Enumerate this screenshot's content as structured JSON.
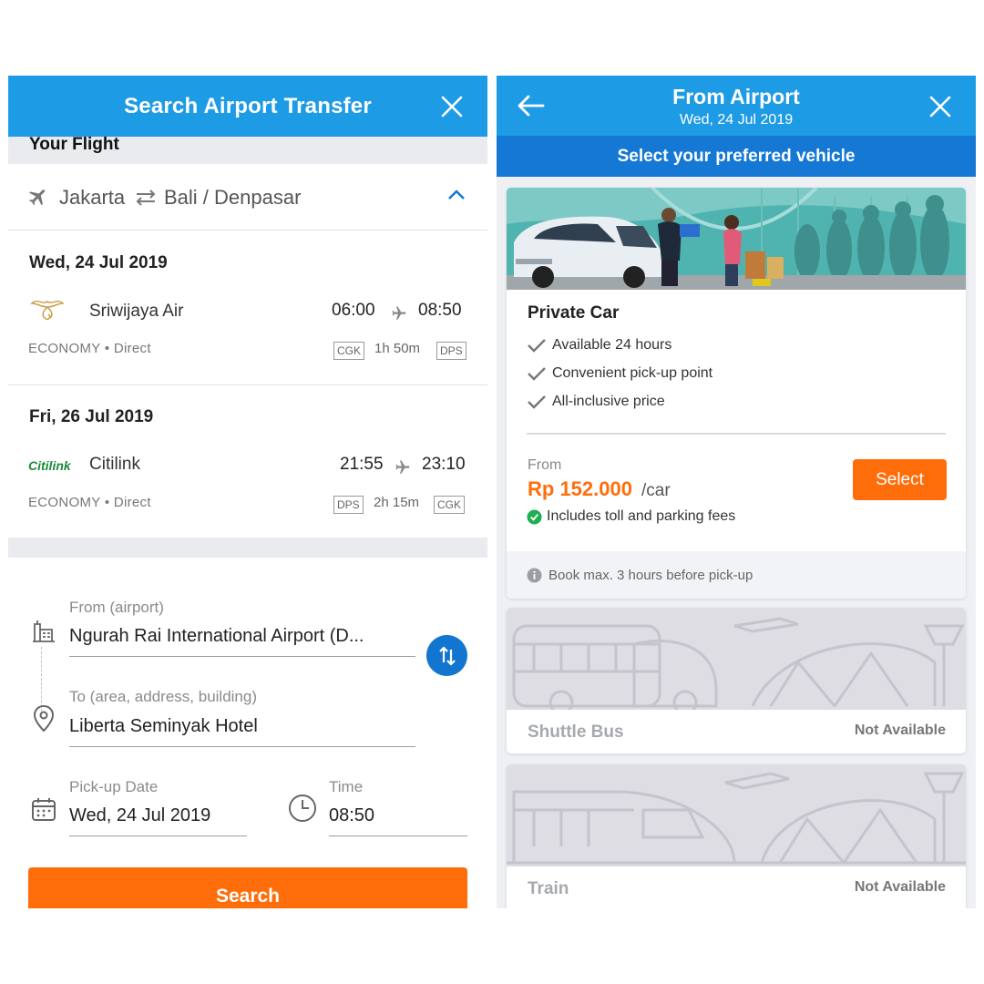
{
  "left": {
    "header": {
      "title": "Search Airport Transfer"
    },
    "section_title": "Your Flight",
    "route": {
      "origin": "Jakarta",
      "destination": "Bali / Denpasar"
    },
    "flights": [
      {
        "date": "Wed, 24 Jul 2019",
        "airline": "Sriwijaya Air",
        "depart": "06:00",
        "arrive": "08:50",
        "cabin": "ECONOMY",
        "separator": "•",
        "type": "Direct",
        "from_code": "CGK",
        "duration": "1h 50m",
        "to_code": "DPS"
      },
      {
        "date": "Fri, 26 Jul 2019",
        "airline": "Citilink",
        "airline_logo_text": "Citilink",
        "depart": "21:55",
        "arrive": "23:10",
        "cabin": "ECONOMY",
        "separator": "•",
        "type": "Direct",
        "from_code": "DPS",
        "duration": "2h 15m",
        "to_code": "CGK"
      }
    ],
    "form": {
      "from_label": "From (airport)",
      "from_value": "Ngurah Rai International Airport (D...",
      "to_label": "To (area, address, building)",
      "to_value": "Liberta Seminyak Hotel",
      "date_label": "Pick-up Date",
      "date_value": "Wed, 24 Jul 2019",
      "time_label": "Time",
      "time_value": "08:50"
    },
    "search_label": "Search"
  },
  "right": {
    "header": {
      "title": "From Airport",
      "subtitle": "Wed, 24 Jul 2019"
    },
    "subheader": "Select your preferred vehicle",
    "vehicles": [
      {
        "name": "Private Car",
        "features": [
          "Available 24 hours",
          "Convenient pick-up point",
          "All-inclusive price"
        ],
        "from_label": "From",
        "price": "Rp 152.000",
        "unit": "/car",
        "select_label": "Select",
        "includes": "Includes toll and parking fees",
        "note": "Book max. 3 hours before pick-up"
      },
      {
        "name": "Shuttle Bus",
        "status": "Not Available"
      },
      {
        "name": "Train",
        "status": "Not Available"
      }
    ]
  },
  "colors": {
    "header_blue": "#1e9be5",
    "subheader_blue": "#1578d4",
    "accent_orange": "#ff6d0a",
    "swap_blue": "#1276d0",
    "check_green": "#1fae52"
  },
  "icons": [
    "close-icon",
    "plane-icon",
    "swap-horizontal-icon",
    "chevron-up-icon",
    "swap-vertical-icon",
    "airport-building-icon",
    "location-pin-icon",
    "calendar-icon",
    "clock-icon",
    "back-arrow-icon",
    "checkmark-icon",
    "check-circle-icon",
    "info-icon"
  ]
}
